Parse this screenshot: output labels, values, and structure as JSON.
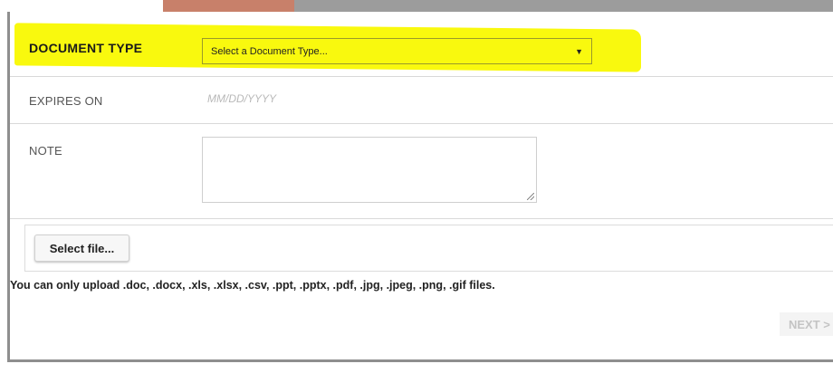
{
  "form": {
    "document_type": {
      "label": "DOCUMENT TYPE",
      "selected": "Select a Document Type...",
      "caret": "▼"
    },
    "expires_on": {
      "label": "EXPIRES ON",
      "placeholder": "MM/DD/YYYY"
    },
    "note": {
      "label": "NOTE",
      "value": ""
    }
  },
  "upload": {
    "button_label": "Select file...",
    "allowed_note": "You can only upload .doc, .docx, .xls, .xlsx, .csv, .ppt, .pptx, .pdf, .jpg, .jpeg, .png, .gif files."
  },
  "actions": {
    "next_label": "NEXT >"
  },
  "colors": {
    "highlight": "#f9f90e",
    "accent": "#c8806a",
    "bar": "#9c9c9c"
  }
}
